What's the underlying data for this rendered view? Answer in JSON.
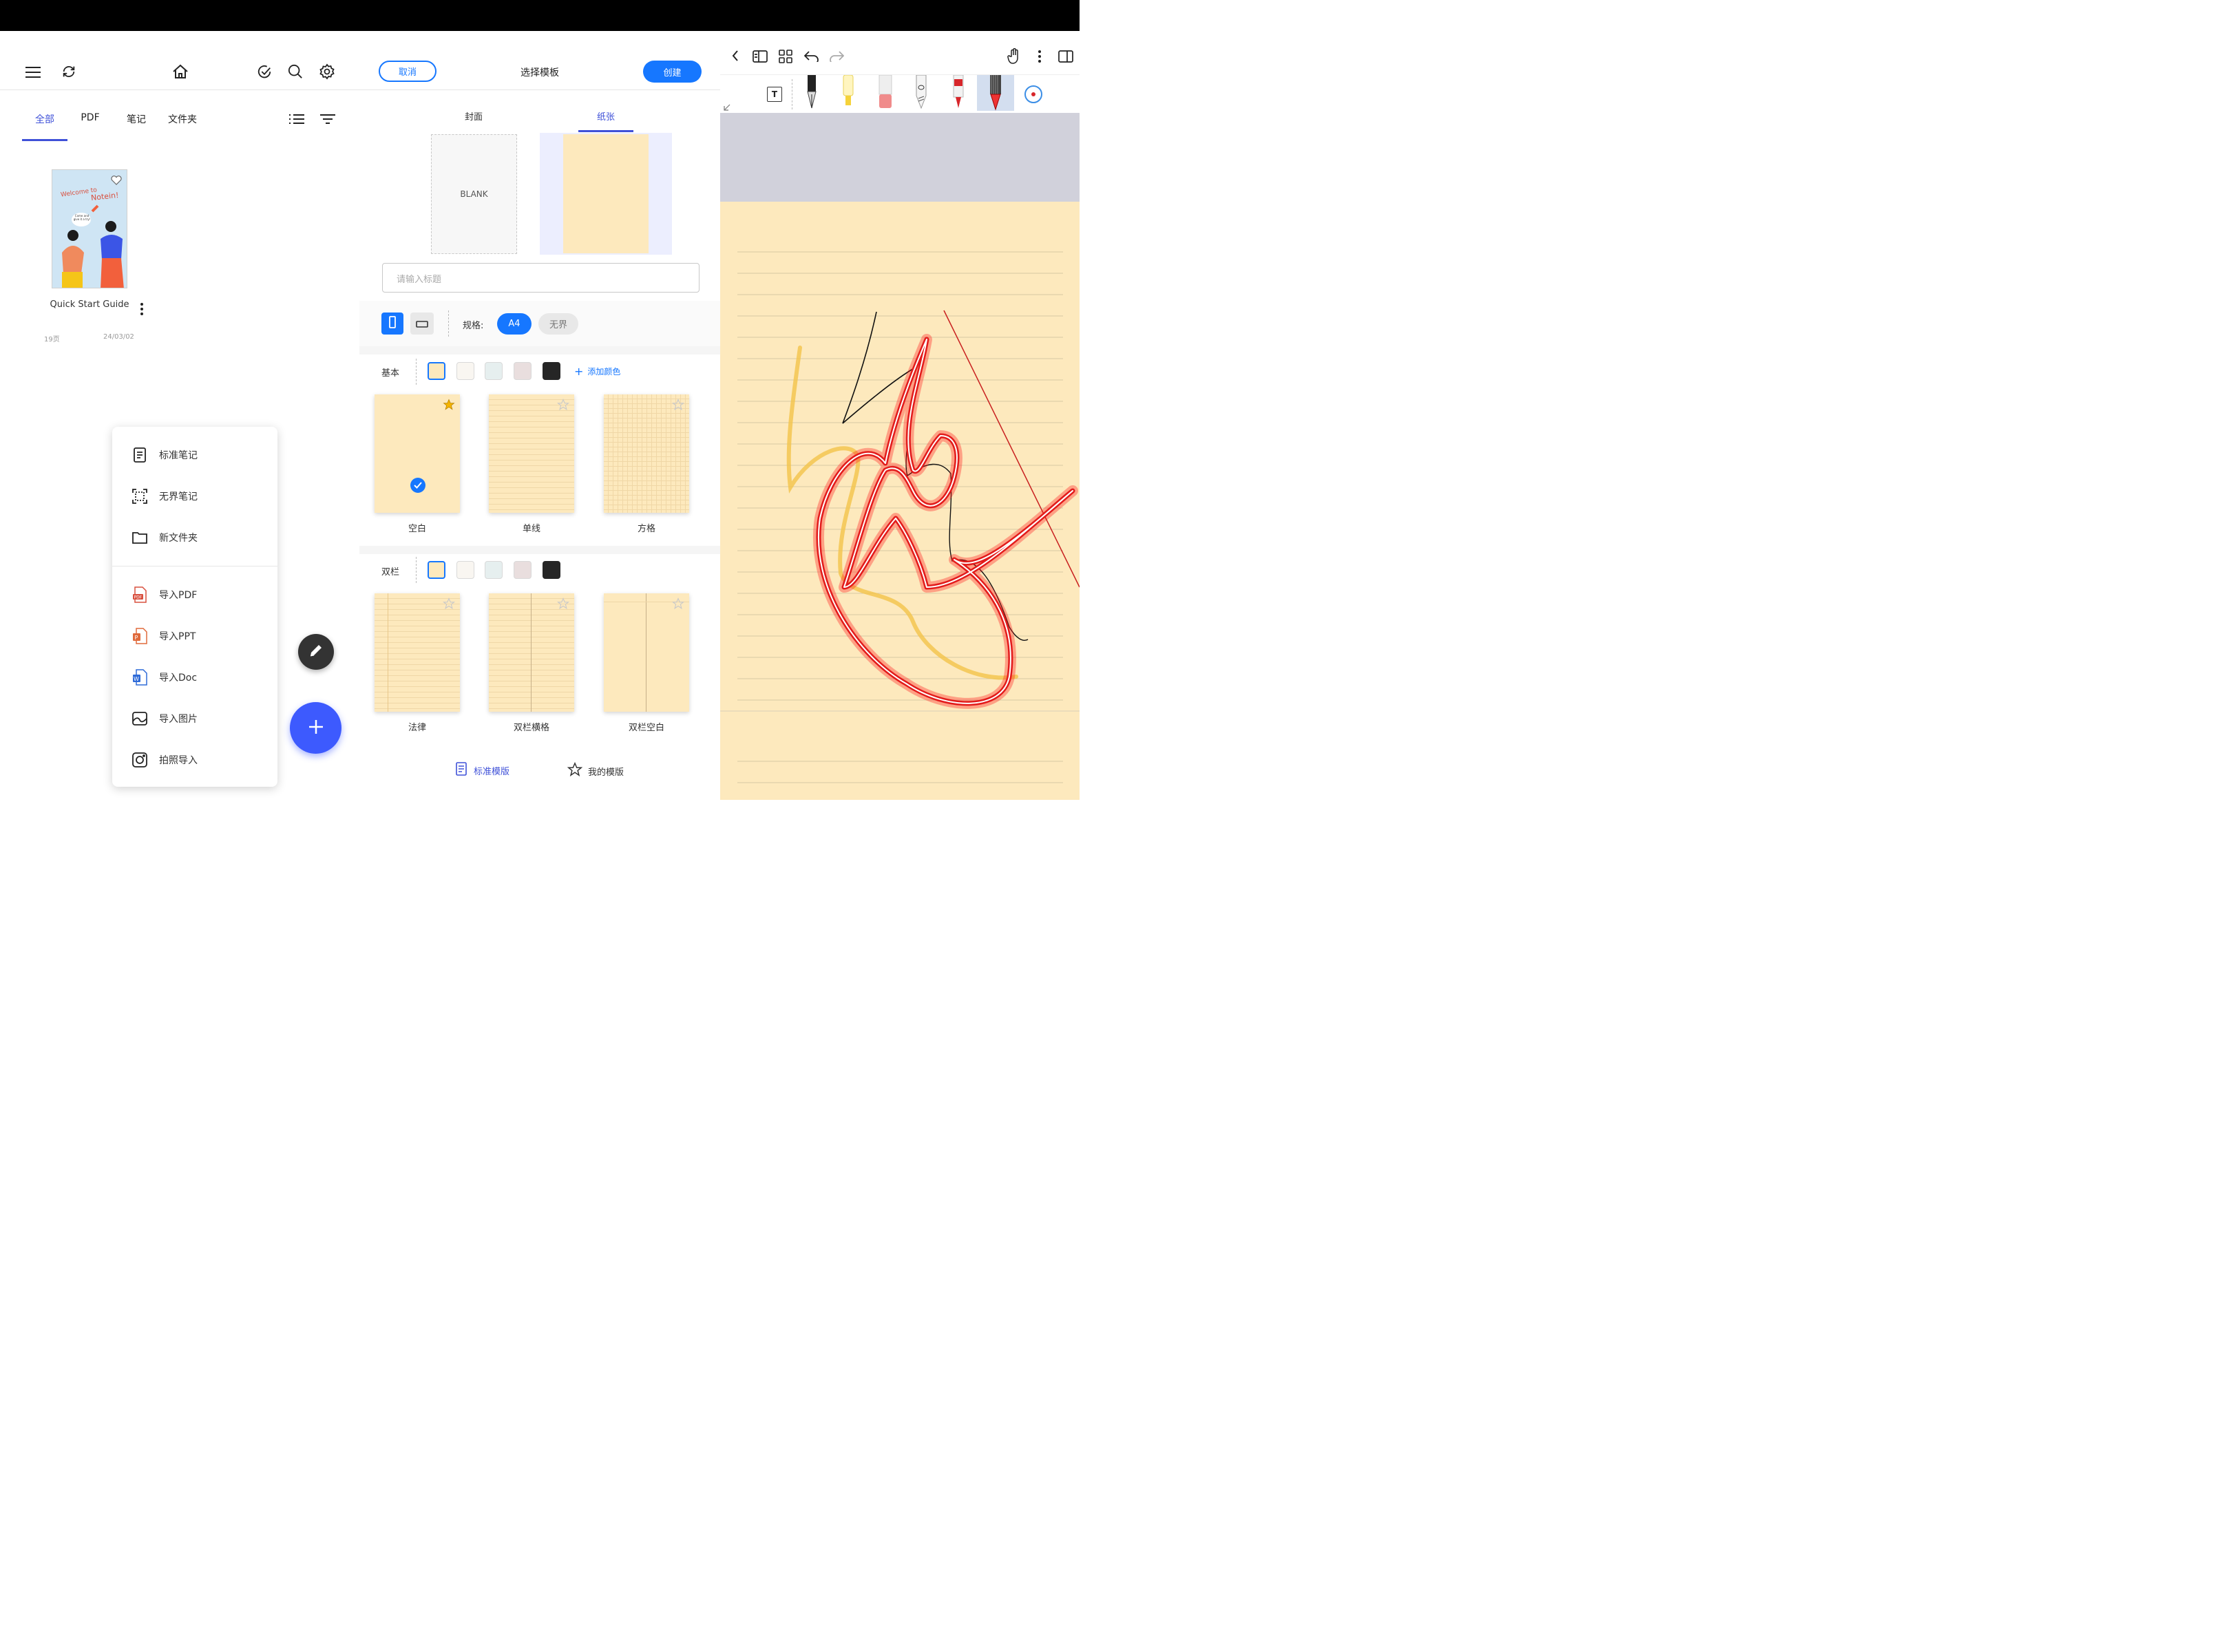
{
  "panel1": {
    "filter_tabs": [
      {
        "label": "全部",
        "active": true
      },
      {
        "label": "PDF",
        "active": false
      },
      {
        "label": "笔记",
        "active": false
      },
      {
        "label": "文件夹",
        "active": false
      }
    ],
    "document": {
      "cover_line1": "Welcome to",
      "cover_line2": "Notein!",
      "cover_bubble": "Come and give it a try!",
      "title": "Quick Start Guide",
      "pages": "19页",
      "date": "24/03/02"
    },
    "create_menu": {
      "items": [
        {
          "label": "标准笔记",
          "icon": "document-icon"
        },
        {
          "label": "无界笔记",
          "icon": "frame-icon"
        },
        {
          "label": "新文件夹",
          "icon": "folder-icon"
        }
      ],
      "imports": [
        {
          "label": "导入PDF",
          "icon": "pdf-file-icon"
        },
        {
          "label": "导入PPT",
          "icon": "ppt-file-icon"
        },
        {
          "label": "导入Doc",
          "icon": "word-file-icon"
        },
        {
          "label": "导入图片",
          "icon": "image-icon"
        },
        {
          "label": "拍照导入",
          "icon": "camera-icon"
        }
      ]
    }
  },
  "panel2": {
    "cancel_label": "取消",
    "title": "选择模板",
    "create_label": "创建",
    "tabs": [
      {
        "label": "封面",
        "active": false
      },
      {
        "label": "纸张",
        "active": true
      }
    ],
    "cover_blank_label": "BLANK",
    "title_placeholder": "请输入标题",
    "size_label": "规格:",
    "size_options": [
      {
        "label": "A4",
        "active": true
      },
      {
        "label": "无界",
        "active": false
      }
    ],
    "basic_section": {
      "label": "基本",
      "add_color": "添加颜色"
    },
    "colors": [
      "#fde9bd",
      "#f9f6f1",
      "#e6efef",
      "#e9dede",
      "#262626"
    ],
    "basic_templates": [
      {
        "label": "空白",
        "favorite": true,
        "selected": true
      },
      {
        "label": "单线",
        "favorite": false,
        "selected": false
      },
      {
        "label": "方格",
        "favorite": false,
        "selected": false
      }
    ],
    "double_section": {
      "label": "双栏"
    },
    "double_templates": [
      {
        "label": "法律",
        "favorite": false
      },
      {
        "label": "双栏横格",
        "favorite": false
      },
      {
        "label": "双栏空白",
        "favorite": false
      }
    ],
    "bottom_tabs": [
      {
        "label": "标准模版",
        "active": true
      },
      {
        "label": "我的模版",
        "active": false
      }
    ]
  },
  "theme": {
    "accent": "#1677ff",
    "tab_accent": "#3f51d8",
    "paper": "#fde9bd",
    "menu_fab": "#3d5afe"
  }
}
